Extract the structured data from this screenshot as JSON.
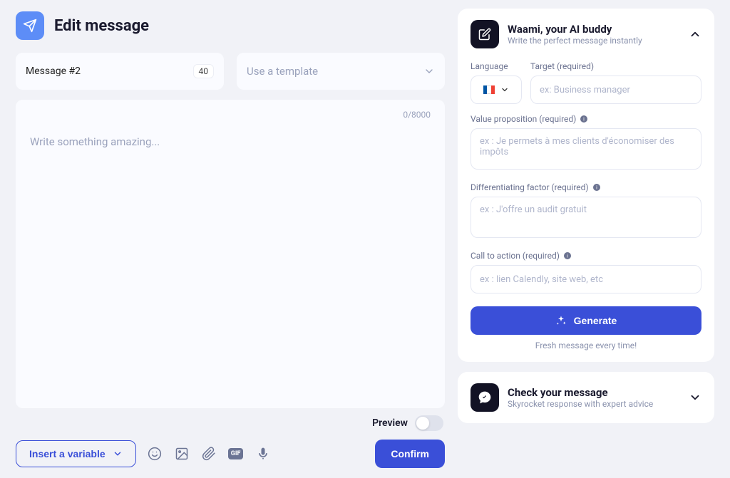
{
  "header": {
    "title": "Edit message"
  },
  "message_box": {
    "label": "Message #2",
    "badge": "40"
  },
  "template_select": {
    "placeholder": "Use a template"
  },
  "editor": {
    "placeholder": "Write something amazing...",
    "counter": "0/8000"
  },
  "preview": {
    "label": "Preview"
  },
  "toolbar": {
    "insert_variable": "Insert a variable",
    "gif_label": "GIF"
  },
  "confirm_label": "Confirm",
  "ai_panel": {
    "title": "Waami, your AI buddy",
    "subtitle": "Write the perfect message instantly",
    "language_label": "Language",
    "target_label": "Target (required)",
    "target_placeholder": "ex: Business manager",
    "value_prop_label": "Value proposition (required)",
    "value_prop_placeholder": "ex : Je permets à mes clients d'économiser des impôts",
    "diff_label": "Differentiating factor (required)",
    "diff_placeholder": "ex : J'offre un audit gratuit",
    "cta_label": "Call to action (required)",
    "cta_placeholder": "ex : lien Calendly, site web, etc",
    "generate_label": "Generate",
    "fresh_note": "Fresh message every time!"
  },
  "check_panel": {
    "title": "Check your message",
    "subtitle": "Skyrocket response with expert advice"
  }
}
